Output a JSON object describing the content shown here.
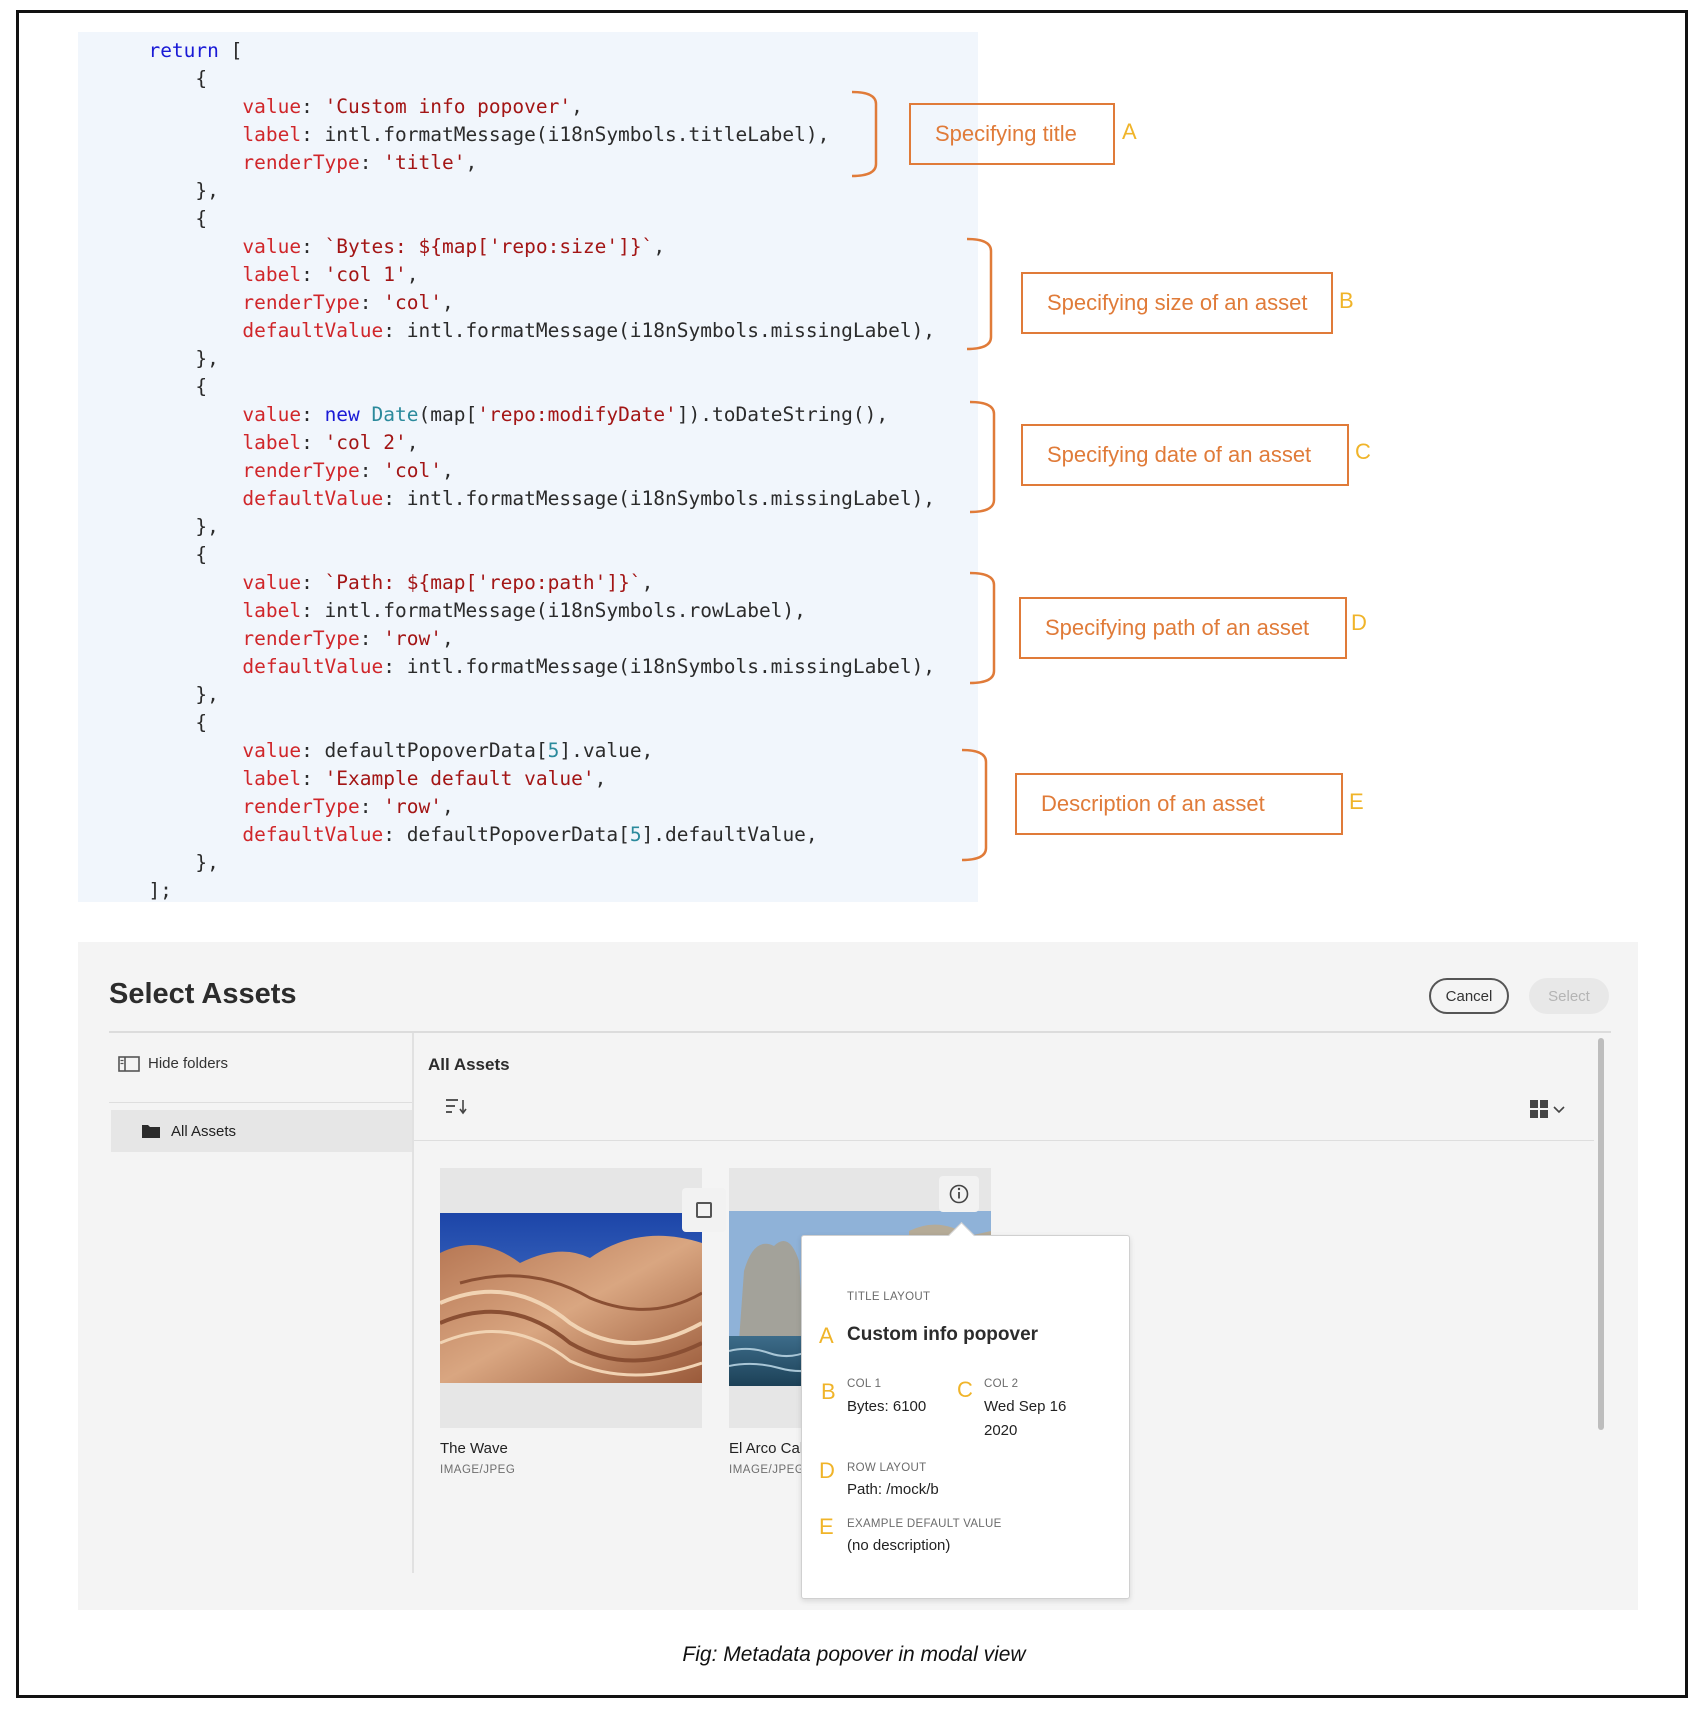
{
  "code": {
    "lines": [
      "return [",
      "    {",
      "        value: 'Custom info popover',",
      "        label: intl.formatMessage(i18nSymbols.titleLabel),",
      "        renderType: 'title',",
      "    },",
      "    {",
      "        value: `Bytes: ${map['repo:size']}`,",
      "        label: 'col 1',",
      "        renderType: 'col',",
      "        defaultValue: intl.formatMessage(i18nSymbols.missingLabel),",
      "    },",
      "    {",
      "        value: new Date(map['repo:modifyDate']).toDateString(),",
      "        label: 'col 2',",
      "        renderType: 'col',",
      "        defaultValue: intl.formatMessage(i18nSymbols.missingLabel),",
      "    },",
      "    {",
      "        value: `Path: ${map['repo:path']}`,",
      "        label: intl.formatMessage(i18nSymbols.rowLabel),",
      "        renderType: 'row',",
      "        defaultValue: intl.formatMessage(i18nSymbols.missingLabel),",
      "    },",
      "    {",
      "        value: defaultPopoverData[5].value,",
      "        label: 'Example default value',",
      "        renderType: 'row',",
      "        defaultValue: defaultPopoverData[5].defaultValue,",
      "    },",
      "];"
    ]
  },
  "annotations": [
    {
      "label": "Specifying title",
      "letter": "A"
    },
    {
      "label": "Specifying size of an asset",
      "letter": "B"
    },
    {
      "label": "Specifying date of an asset",
      "letter": "C"
    },
    {
      "label": "Specifying path of an asset",
      "letter": "D"
    },
    {
      "label": "Description of an asset",
      "letter": "E"
    }
  ],
  "modal": {
    "title": "Select Assets",
    "cancel_label": "Cancel",
    "select_label": "Select",
    "hide_folders_label": "Hide folders",
    "folder_label": "All Assets",
    "content_title": "All Assets",
    "cards": [
      {
        "name": "The Wave",
        "type": "IMAGE/JPEG"
      },
      {
        "name": "El Arco Cab",
        "type": "IMAGE/JPEG"
      }
    ]
  },
  "popover": {
    "layout_label": "TITLE LAYOUT",
    "title": "Custom info popover",
    "col1_label": "COL 1",
    "col1_value": "Bytes: 6100",
    "col2_label": "COL 2",
    "col2_value_line1": "Wed Sep 16",
    "col2_value_line2": "2020",
    "row_label": "ROW LAYOUT",
    "row_value": "Path: /mock/b",
    "default_label": "EXAMPLE DEFAULT VALUE",
    "default_value": "(no description)",
    "letters": {
      "a": "A",
      "b": "B",
      "c": "C",
      "d": "D",
      "e": "E"
    }
  },
  "caption": "Fig: Metadata popover in modal view",
  "colors": {
    "annotation": "#e07b39",
    "letter": "#f0b429",
    "code_bg": "#f1f6fc",
    "modal_bg": "#f4f4f4"
  }
}
